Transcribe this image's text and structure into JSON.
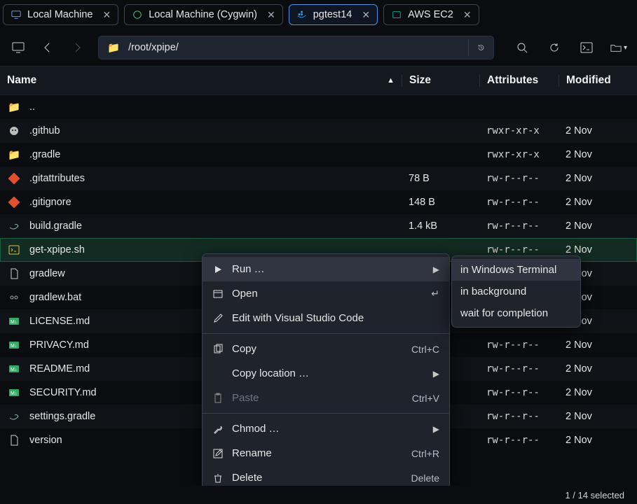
{
  "tabs": [
    {
      "label": "Local Machine",
      "icon": "desktop-icon",
      "active": false
    },
    {
      "label": "Local Machine (Cygwin)",
      "icon": "cygwin-icon",
      "active": false
    },
    {
      "label": "pgtest14",
      "icon": "docker-icon",
      "active": true
    },
    {
      "label": "AWS EC2",
      "icon": "aws-icon",
      "active": false
    }
  ],
  "toolbar": {
    "path": "/root/xpipe/"
  },
  "columns": {
    "name": "Name",
    "size": "Size",
    "attr": "Attributes",
    "mod": "Modified"
  },
  "files": [
    {
      "icon": "folder-up-icon",
      "name": "..",
      "size": "",
      "attr": "",
      "mod": "",
      "selected": false
    },
    {
      "icon": "github-icon",
      "name": ".github",
      "size": "",
      "attr": "rwxr-xr-x",
      "mod": "2 Nov",
      "selected": false
    },
    {
      "icon": "gradle-folder-icon",
      "name": ".gradle",
      "size": "",
      "attr": "rwxr-xr-x",
      "mod": "2 Nov",
      "selected": false
    },
    {
      "icon": "git-icon",
      "name": ".gitattributes",
      "size": "78 B",
      "attr": "rw-r--r--",
      "mod": "2 Nov",
      "selected": false
    },
    {
      "icon": "git-icon",
      "name": ".gitignore",
      "size": "148 B",
      "attr": "rw-r--r--",
      "mod": "2 Nov",
      "selected": false
    },
    {
      "icon": "gradle-icon",
      "name": "build.gradle",
      "size": "1.4 kB",
      "attr": "rw-r--r--",
      "mod": "2 Nov",
      "selected": false
    },
    {
      "icon": "shell-icon",
      "name": "get-xpipe.sh",
      "size": "",
      "attr": "rw-r--r--",
      "mod": "2 Nov",
      "selected": true
    },
    {
      "icon": "file-icon",
      "name": "gradlew",
      "size": "",
      "attr": "",
      "mod": "2 Nov",
      "selected": false
    },
    {
      "icon": "batch-icon",
      "name": "gradlew.bat",
      "size": "",
      "attr": "",
      "mod": "2 Nov",
      "selected": false
    },
    {
      "icon": "markdown-icon",
      "name": "LICENSE.md",
      "size": "",
      "attr": "",
      "mod": "2 Nov",
      "selected": false
    },
    {
      "icon": "markdown-icon",
      "name": "PRIVACY.md",
      "size": "",
      "attr": "rw-r--r--",
      "mod": "2 Nov",
      "selected": false
    },
    {
      "icon": "markdown-icon",
      "name": "README.md",
      "size": "",
      "attr": "rw-r--r--",
      "mod": "2 Nov",
      "selected": false
    },
    {
      "icon": "markdown-icon",
      "name": "SECURITY.md",
      "size": "",
      "attr": "rw-r--r--",
      "mod": "2 Nov",
      "selected": false
    },
    {
      "icon": "gradle-icon",
      "name": "settings.gradle",
      "size": "",
      "attr": "rw-r--r--",
      "mod": "2 Nov",
      "selected": false
    },
    {
      "icon": "file-icon",
      "name": "version",
      "size": "",
      "attr": "rw-r--r--",
      "mod": "2 Nov",
      "selected": false
    }
  ],
  "context_menu": {
    "items": [
      {
        "icon": "play-icon",
        "label": "Run …",
        "accel": "",
        "arrow": true,
        "hover": true,
        "disabled": false
      },
      {
        "icon": "open-icon",
        "label": "Open",
        "accel": "↵",
        "arrow": false,
        "hover": false,
        "disabled": false
      },
      {
        "icon": "pencil-icon",
        "label": "Edit with Visual Studio Code",
        "accel": "",
        "arrow": false,
        "hover": false,
        "disabled": false
      },
      {
        "sep": true
      },
      {
        "icon": "copy-icon",
        "label": "Copy",
        "accel": "Ctrl+C",
        "arrow": false,
        "hover": false,
        "disabled": false
      },
      {
        "icon": "",
        "label": "Copy location …",
        "accel": "",
        "arrow": true,
        "hover": false,
        "disabled": false
      },
      {
        "icon": "paste-icon",
        "label": "Paste",
        "accel": "Ctrl+V",
        "arrow": false,
        "hover": false,
        "disabled": true
      },
      {
        "sep": true
      },
      {
        "icon": "wrench-icon",
        "label": "Chmod …",
        "accel": "",
        "arrow": true,
        "hover": false,
        "disabled": false
      },
      {
        "icon": "rename-icon",
        "label": "Rename",
        "accel": "Ctrl+R",
        "arrow": false,
        "hover": false,
        "disabled": false
      },
      {
        "icon": "trash-icon",
        "label": "Delete",
        "accel": "Delete",
        "arrow": false,
        "hover": false,
        "disabled": false
      }
    ],
    "submenu": [
      {
        "label": "in Windows Terminal",
        "hover": true
      },
      {
        "label": "in background",
        "hover": false
      },
      {
        "label": "wait for completion",
        "hover": false
      }
    ]
  },
  "status": {
    "selection": "1 / 14 selected"
  }
}
